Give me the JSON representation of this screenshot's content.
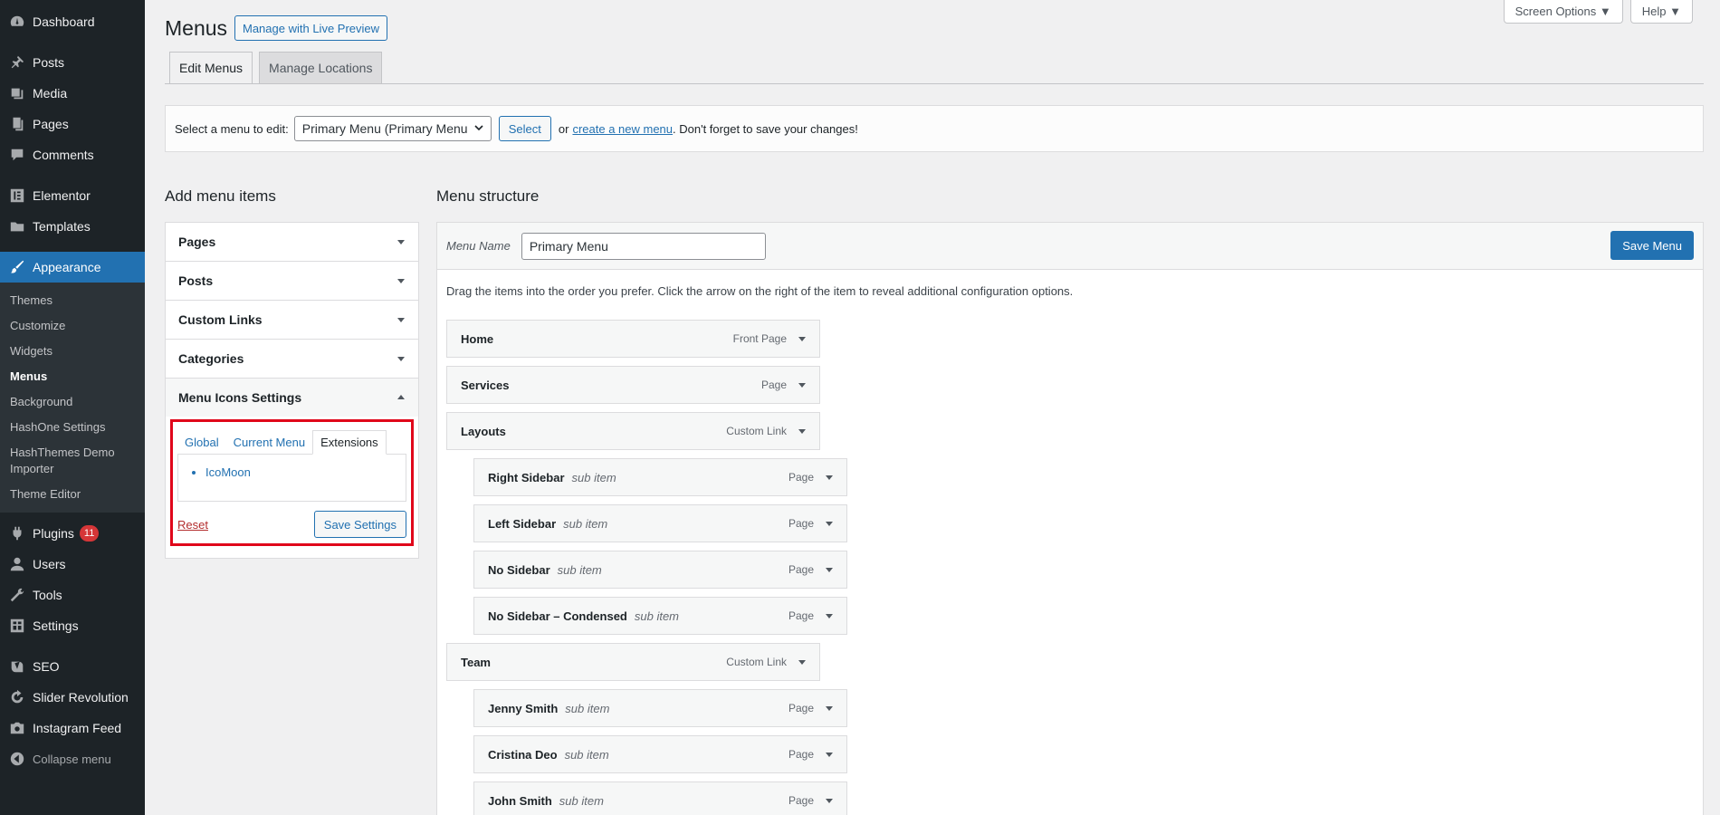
{
  "sidebar": {
    "items": [
      {
        "label": "Dashboard",
        "icon": "dashboard-icon"
      },
      {
        "label": "Posts",
        "icon": "pushpin-icon"
      },
      {
        "label": "Media",
        "icon": "media-icon"
      },
      {
        "label": "Pages",
        "icon": "pages-icon"
      },
      {
        "label": "Comments",
        "icon": "comment-icon"
      },
      {
        "label": "Elementor",
        "icon": "elementor-icon"
      },
      {
        "label": "Templates",
        "icon": "folder-icon"
      },
      {
        "label": "Appearance",
        "icon": "paintbrush-icon"
      },
      {
        "label": "Plugins",
        "icon": "plugin-icon",
        "badge": "11"
      },
      {
        "label": "Users",
        "icon": "user-icon"
      },
      {
        "label": "Tools",
        "icon": "wrench-icon"
      },
      {
        "label": "Settings",
        "icon": "settings-icon"
      },
      {
        "label": "SEO",
        "icon": "yoast-icon"
      },
      {
        "label": "Slider Revolution",
        "icon": "refresh-icon"
      },
      {
        "label": "Instagram Feed",
        "icon": "camera-icon"
      },
      {
        "label": "Collapse menu",
        "icon": "collapse-icon"
      }
    ],
    "submenu": [
      "Themes",
      "Customize",
      "Widgets",
      "Menus",
      "Background",
      "HashOne Settings",
      "HashThemes Demo Importer",
      "Theme Editor"
    ]
  },
  "top": {
    "screen_options": "Screen Options",
    "help": "Help"
  },
  "header": {
    "title": "Menus",
    "live_preview": "Manage with Live Preview"
  },
  "tabs": [
    "Edit Menus",
    "Manage Locations"
  ],
  "manage": {
    "prompt": "Select a menu to edit:",
    "selected": "Primary Menu (Primary Menu)",
    "select_btn": "Select",
    "or": "or",
    "create_link": "create a new menu",
    "suffix": ". Don't forget to save your changes!"
  },
  "add_items": {
    "heading": "Add menu items",
    "sections": [
      "Pages",
      "Posts",
      "Custom Links",
      "Categories",
      "Menu Icons Settings"
    ],
    "icons_tabs": [
      "Global",
      "Current Menu",
      "Extensions"
    ],
    "extensions": [
      "IcoMoon"
    ],
    "reset": "Reset",
    "save_settings": "Save Settings"
  },
  "structure": {
    "heading": "Menu structure",
    "name_label": "Menu Name",
    "name_value": "Primary Menu",
    "save": "Save Menu",
    "instructions": "Drag the items into the order you prefer. Click the arrow on the right of the item to reveal additional configuration options.",
    "items": [
      {
        "title": "Home",
        "sub": "",
        "type": "Front Page",
        "depth": 0
      },
      {
        "title": "Services",
        "sub": "",
        "type": "Page",
        "depth": 0
      },
      {
        "title": "Layouts",
        "sub": "",
        "type": "Custom Link",
        "depth": 0
      },
      {
        "title": "Right Sidebar",
        "sub": "sub item",
        "type": "Page",
        "depth": 1
      },
      {
        "title": "Left Sidebar",
        "sub": "sub item",
        "type": "Page",
        "depth": 1
      },
      {
        "title": "No Sidebar",
        "sub": "sub item",
        "type": "Page",
        "depth": 1
      },
      {
        "title": "No Sidebar – Condensed",
        "sub": "sub item",
        "type": "Page",
        "depth": 1
      },
      {
        "title": "Team",
        "sub": "",
        "type": "Custom Link",
        "depth": 0
      },
      {
        "title": "Jenny Smith",
        "sub": "sub item",
        "type": "Page",
        "depth": 1
      },
      {
        "title": "Cristina Deo",
        "sub": "sub item",
        "type": "Page",
        "depth": 1
      },
      {
        "title": "John Smith",
        "sub": "sub item",
        "type": "Page",
        "depth": 1
      }
    ]
  },
  "colors": {
    "accent": "#2271b1",
    "sidebar_bg": "#1d2327",
    "highlight": "#e0061a"
  }
}
